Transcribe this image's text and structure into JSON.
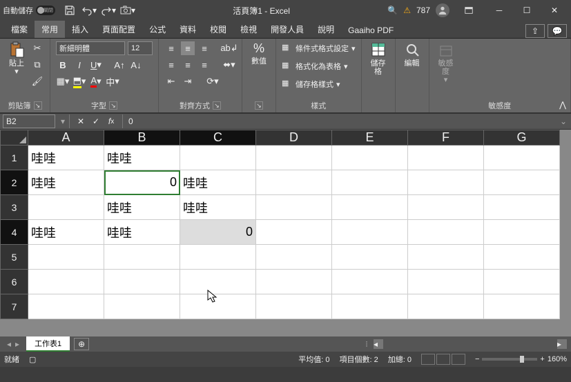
{
  "titlebar": {
    "autosave": "自動儲存",
    "toggle_state": "關閉",
    "title": "活頁簿1 - Excel",
    "notif_count": "787"
  },
  "tabs": {
    "file": "檔案",
    "home": "常用",
    "insert": "插入",
    "layout": "頁面配置",
    "formulas": "公式",
    "data": "資料",
    "review": "校閱",
    "view": "檢視",
    "developer": "開發人員",
    "help": "說明",
    "gaaiho": "Gaaiho PDF"
  },
  "ribbon": {
    "clipboard": {
      "paste": "貼上",
      "label": "剪貼簿"
    },
    "font": {
      "name": "新細明體",
      "size": "12",
      "phonetic": "中",
      "label": "字型"
    },
    "align": {
      "label": "對齊方式"
    },
    "number": {
      "label": "數值"
    },
    "styles": {
      "cond": "條件式格式設定",
      "table": "格式化為表格",
      "cell": "儲存格樣式",
      "label": "樣式"
    },
    "cells": {
      "btn": "儲存格"
    },
    "editing": {
      "btn": "編輯"
    },
    "sensitivity": {
      "btn": "敏感度",
      "label": "敏感度"
    }
  },
  "fbar": {
    "name": "B2",
    "formula": "0"
  },
  "grid": {
    "cols": [
      "A",
      "B",
      "C",
      "D",
      "E",
      "F",
      "G"
    ],
    "rows": [
      {
        "n": "1",
        "cells": [
          "哇哇",
          "哇哇",
          "",
          "",
          "",
          "",
          ""
        ]
      },
      {
        "n": "2",
        "cells": [
          "哇哇",
          "0",
          "哇哇",
          "",
          "",
          "",
          ""
        ]
      },
      {
        "n": "3",
        "cells": [
          "",
          "哇哇",
          "哇哇",
          "",
          "",
          "",
          ""
        ]
      },
      {
        "n": "4",
        "cells": [
          "哇哇",
          "哇哇",
          "0",
          "",
          "",
          "",
          ""
        ]
      },
      {
        "n": "5",
        "cells": [
          "",
          "",
          "",
          "",
          "",
          "",
          ""
        ]
      },
      {
        "n": "6",
        "cells": [
          "",
          "",
          "",
          "",
          "",
          "",
          ""
        ]
      },
      {
        "n": "7",
        "cells": [
          "",
          "",
          "",
          "",
          "",
          "",
          ""
        ]
      }
    ],
    "sel": {
      "row": 1,
      "col": 1
    },
    "fill": {
      "row": 3,
      "col": 2
    }
  },
  "sheettabs": {
    "sheet1": "工作表1"
  },
  "status": {
    "ready": "就緒",
    "avg": "平均值: 0",
    "count": "項目個數: 2",
    "sum": "加總: 0",
    "zoom": "160%"
  }
}
